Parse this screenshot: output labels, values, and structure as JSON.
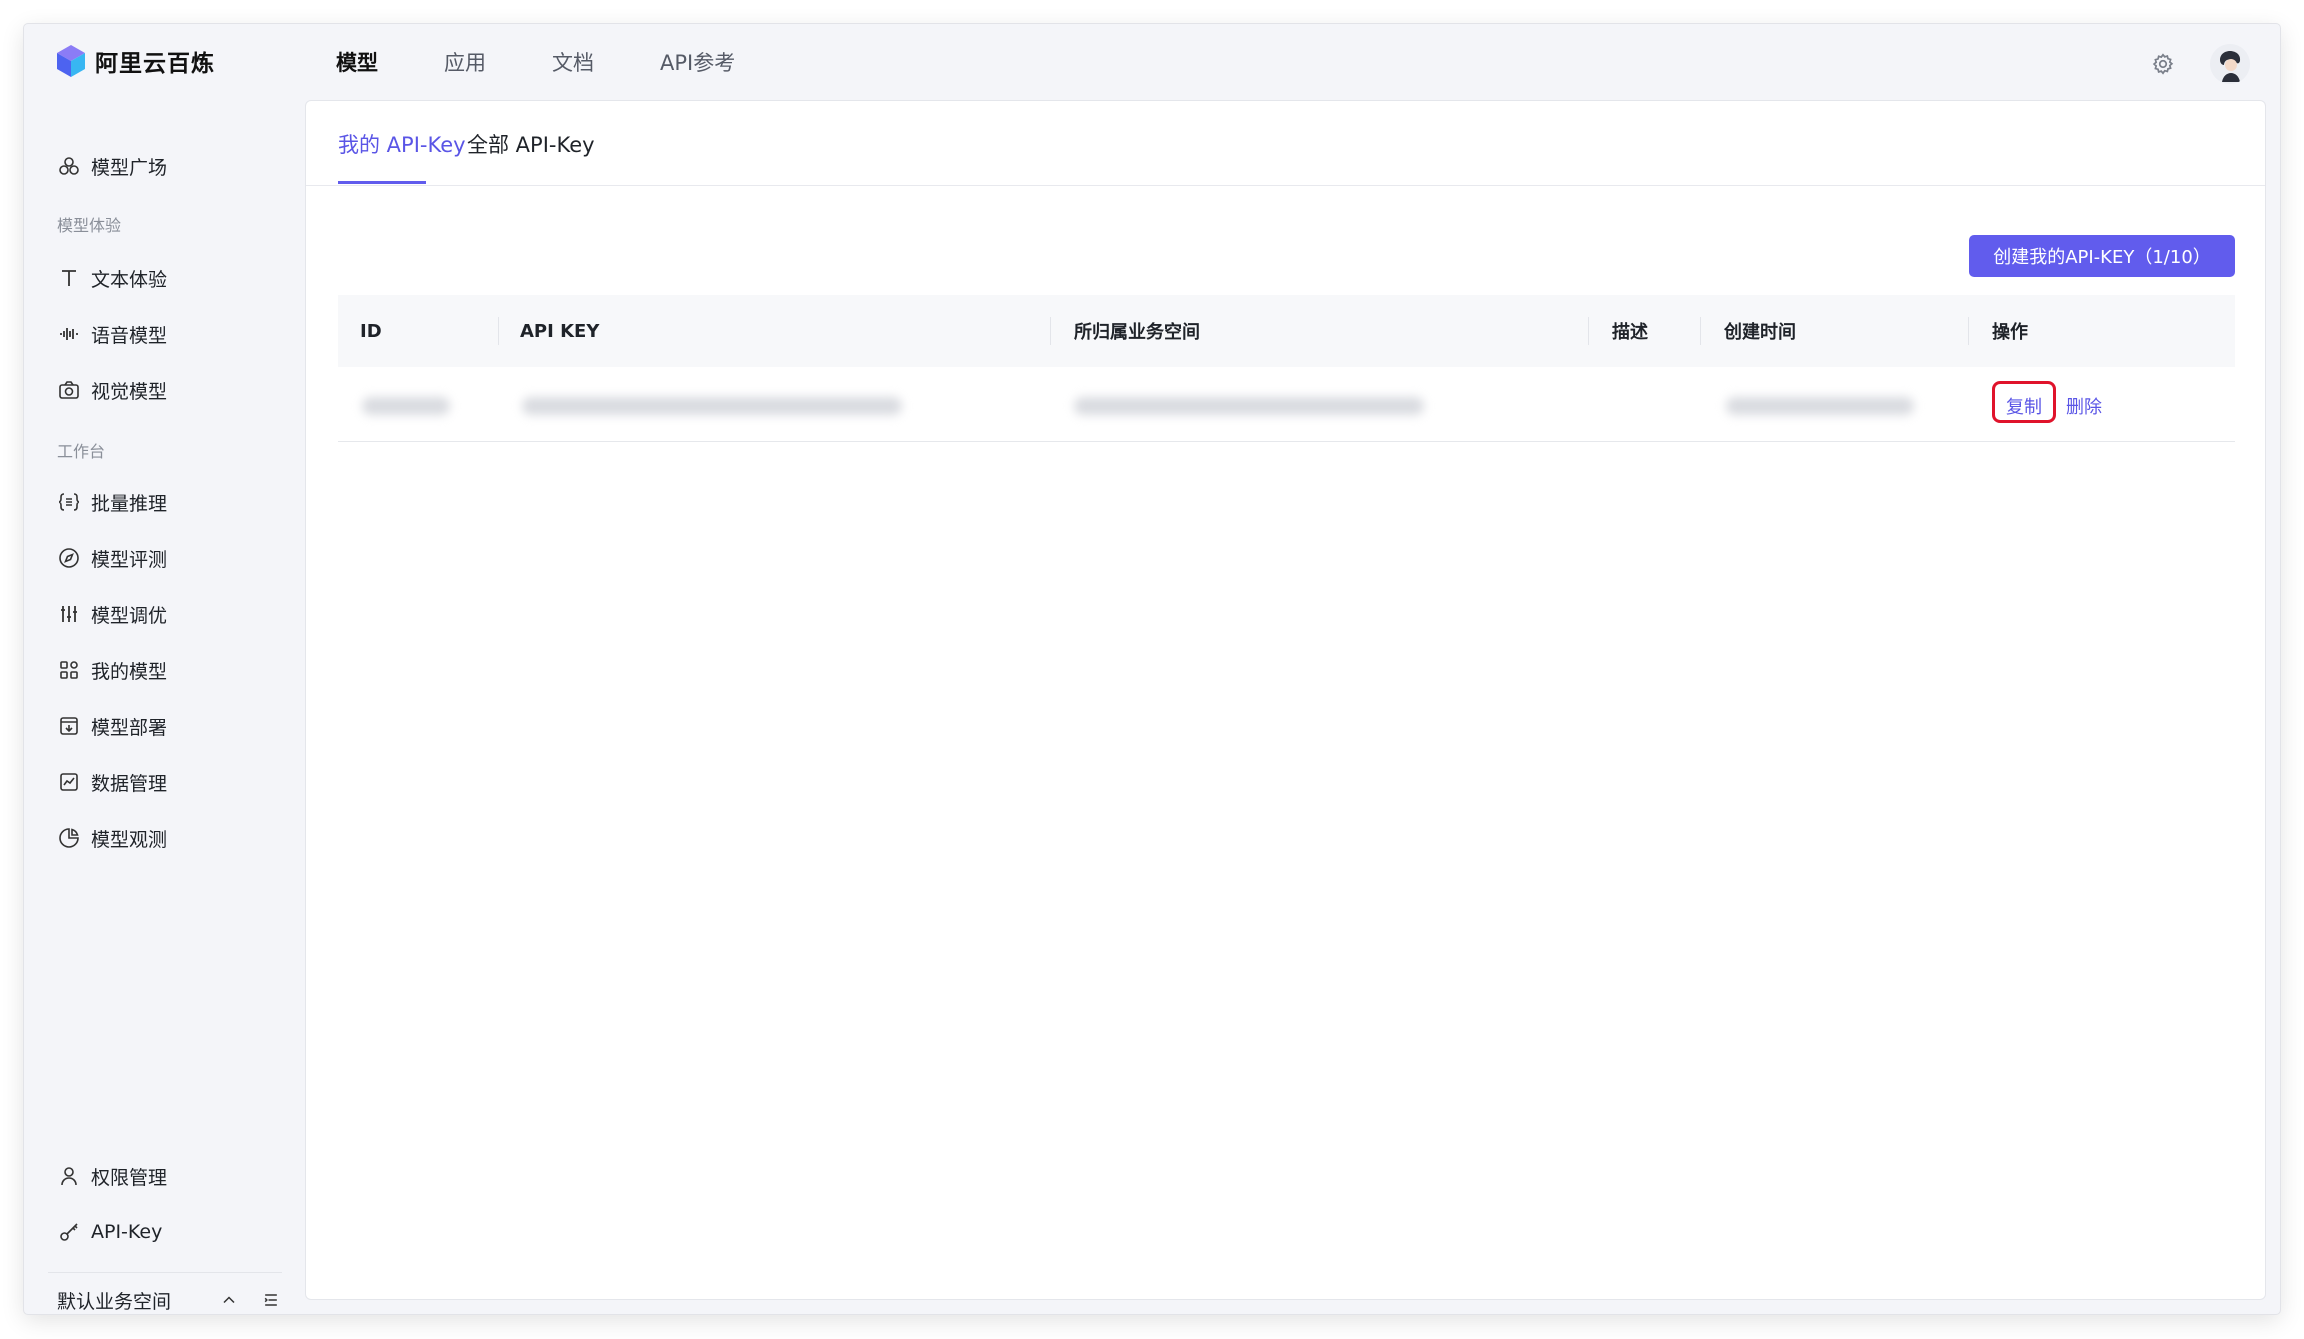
{
  "app": {
    "brand": "阿里云百炼"
  },
  "topnav": {
    "items": [
      {
        "label": "模型"
      },
      {
        "label": "应用"
      },
      {
        "label": "文档"
      },
      {
        "label": "API参考"
      }
    ],
    "active_index": 0
  },
  "sidebar": {
    "model_square": "模型广场",
    "group_experience": "模型体验",
    "text_experience": "文本体验",
    "speech_model": "语音模型",
    "vision_model": "视觉模型",
    "group_workbench": "工作台",
    "batch_inference": "批量推理",
    "model_evaluation": "模型评测",
    "model_tuning": "模型调优",
    "my_models": "我的模型",
    "model_deploy": "模型部署",
    "data_management": "数据管理",
    "model_observe": "模型观测",
    "permission_management": "权限管理",
    "api_key": "API-Key",
    "workspace": "默认业务空间"
  },
  "tabs": {
    "my_keys": "我的 API-Key",
    "all_keys": "全部 API-Key"
  },
  "create_button": "创建我的API-KEY（1/10）",
  "table": {
    "headers": {
      "id": "ID",
      "api_key": "API KEY",
      "workspace": "所归属业务空间",
      "description": "描述",
      "created_at": "创建时间",
      "actions": "操作"
    },
    "rows": [
      {
        "copy": "复制",
        "delete": "删除"
      }
    ]
  },
  "colors": {
    "accent": "#615ced",
    "highlight": "#e0132b"
  }
}
